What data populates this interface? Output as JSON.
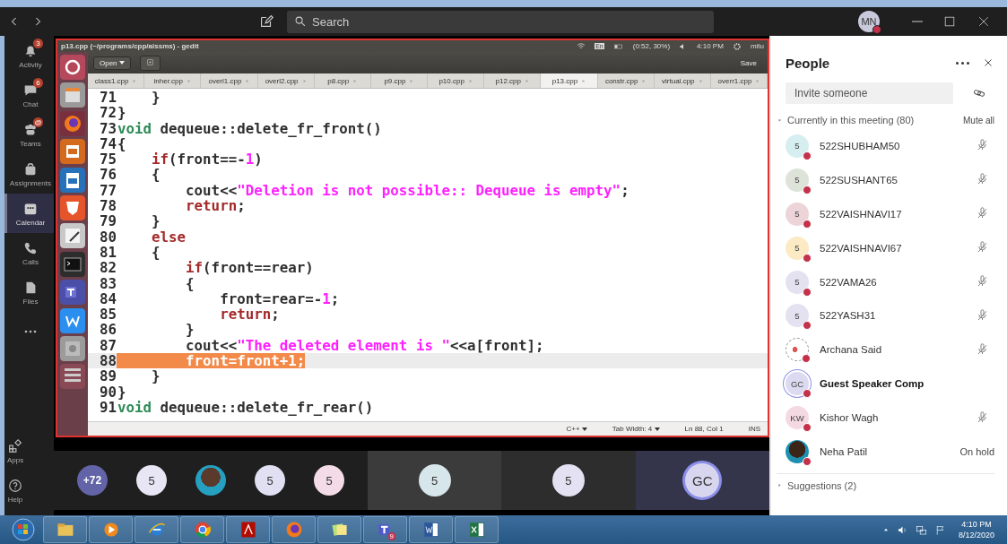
{
  "top_bar": {
    "search_placeholder": "Search",
    "avatar": "MN"
  },
  "rail": [
    {
      "kind": "bell",
      "label": "Activity",
      "badge": "3",
      "selected": false
    },
    {
      "kind": "chat",
      "label": "Chat",
      "badge": "6",
      "selected": false
    },
    {
      "kind": "teams",
      "label": "Teams",
      "badge": "@",
      "selected": false
    },
    {
      "kind": "bag",
      "label": "Assignments",
      "selected": false
    },
    {
      "kind": "calendar",
      "label": "Calendar",
      "selected": true
    },
    {
      "kind": "phone",
      "label": "Calls",
      "selected": false
    },
    {
      "kind": "file",
      "label": "Files",
      "selected": false
    },
    {
      "kind": "more",
      "selected": false
    }
  ],
  "rail_bottom": [
    {
      "kind": "apps",
      "label": "Apps",
      "selected": false
    },
    {
      "kind": "help",
      "label": "Help",
      "selected": false
    }
  ],
  "gedit": {
    "title": "p13.cpp (~/programs/cpp/aissms) - gedit",
    "indicators": {
      "keyboard": "En",
      "battery": "(0:52, 30%)",
      "clock": "4:10 PM",
      "user": "mitu"
    },
    "open_button": "Open",
    "save_button": "Save",
    "tabs": [
      {
        "label": "class1.cpp",
        "selected": false
      },
      {
        "label": "inher.cpp",
        "selected": false
      },
      {
        "label": "overl1.cpp",
        "selected": false
      },
      {
        "label": "overl2.cpp",
        "selected": false
      },
      {
        "label": "p8.cpp",
        "selected": false
      },
      {
        "label": "p9.cpp",
        "selected": false
      },
      {
        "label": "p10.cpp",
        "selected": false
      },
      {
        "label": "p12.cpp",
        "selected": false
      },
      {
        "label": "p13.cpp",
        "selected": true
      },
      {
        "label": "constr.cpp",
        "selected": false
      },
      {
        "label": "virtual.cpp",
        "selected": false
      },
      {
        "label": "overr1.cpp",
        "selected": false
      }
    ],
    "lines": [
      {
        "number": "71",
        "selected": false,
        "segments": [
          {
            "text": "    }",
            "kind": "plain"
          }
        ]
      },
      {
        "number": "72",
        "selected": false,
        "segments": [
          {
            "text": "}",
            "kind": "plain"
          }
        ]
      },
      {
        "number": "73",
        "selected": false,
        "segments": [
          {
            "text": "void",
            "kind": "type"
          },
          {
            "text": " dequeue::delete_fr_front()",
            "kind": "plain"
          }
        ]
      },
      {
        "number": "74",
        "selected": false,
        "segments": [
          {
            "text": "{",
            "kind": "plain"
          }
        ]
      },
      {
        "number": "75",
        "selected": false,
        "segments": [
          {
            "text": "    if",
            "kind": "keyword"
          },
          {
            "text": "(front==-",
            "kind": "plain"
          },
          {
            "text": "1",
            "kind": "number"
          },
          {
            "text": ")",
            "kind": "plain"
          }
        ]
      },
      {
        "number": "76",
        "selected": false,
        "segments": [
          {
            "text": "    {",
            "kind": "plain"
          }
        ]
      },
      {
        "number": "77",
        "selected": false,
        "segments": [
          {
            "text": "        cout<<",
            "kind": "plain"
          },
          {
            "text": "\"Deletion is not possible:: Dequeue is empty\"",
            "kind": "string"
          },
          {
            "text": ";",
            "kind": "plain"
          }
        ]
      },
      {
        "number": "78",
        "selected": false,
        "segments": [
          {
            "text": "        return",
            "kind": "keyword"
          },
          {
            "text": ";",
            "kind": "plain"
          }
        ]
      },
      {
        "number": "79",
        "selected": false,
        "segments": [
          {
            "text": "    }",
            "kind": "plain"
          }
        ]
      },
      {
        "number": "80",
        "selected": false,
        "segments": [
          {
            "text": "    else",
            "kind": "keyword"
          }
        ]
      },
      {
        "number": "81",
        "selected": false,
        "segments": [
          {
            "text": "    {",
            "kind": "plain"
          }
        ]
      },
      {
        "number": "82",
        "selected": false,
        "segments": [
          {
            "text": "        if",
            "kind": "keyword"
          },
          {
            "text": "(front==rear)",
            "kind": "plain"
          }
        ]
      },
      {
        "number": "83",
        "selected": false,
        "segments": [
          {
            "text": "        {",
            "kind": "plain"
          }
        ]
      },
      {
        "number": "84",
        "selected": false,
        "segments": [
          {
            "text": "            front=rear=-",
            "kind": "plain"
          },
          {
            "text": "1",
            "kind": "number"
          },
          {
            "text": ";",
            "kind": "plain"
          }
        ]
      },
      {
        "number": "85",
        "selected": false,
        "segments": [
          {
            "text": "            return",
            "kind": "keyword"
          },
          {
            "text": ";",
            "kind": "plain"
          }
        ]
      },
      {
        "number": "86",
        "selected": false,
        "segments": [
          {
            "text": "        }",
            "kind": "plain"
          }
        ]
      },
      {
        "number": "87",
        "selected": false,
        "segments": [
          {
            "text": "        cout<<",
            "kind": "plain"
          },
          {
            "text": "\"The deleted element is \"",
            "kind": "string"
          },
          {
            "text": "<<a[front];",
            "kind": "plain"
          }
        ]
      },
      {
        "number": "88",
        "selected": true,
        "segments": [
          {
            "text": "        front=front+1;",
            "kind": "plain"
          }
        ]
      },
      {
        "number": "89",
        "selected": false,
        "segments": [
          {
            "text": "    }",
            "kind": "plain"
          }
        ]
      },
      {
        "number": "90",
        "selected": false,
        "segments": [
          {
            "text": "}",
            "kind": "plain"
          }
        ]
      },
      {
        "number": "91",
        "selected": false,
        "segments": [
          {
            "text": "void",
            "kind": "type"
          },
          {
            "text": " dequeue::delete_fr_rear()",
            "kind": "plain"
          }
        ]
      }
    ],
    "status": {
      "language": "C++",
      "tab_width": "Tab Width: 4",
      "position": "Ln 88, Col 1",
      "mode": "INS"
    }
  },
  "participants": [
    {
      "kind": "overflow",
      "label": "+72",
      "color": "#6264a7"
    },
    {
      "kind": "initials",
      "label": "5",
      "color": "#e8e6f4"
    },
    {
      "kind": "photo"
    },
    {
      "kind": "initials",
      "label": "5",
      "color": "#e1dff2"
    },
    {
      "kind": "initials",
      "label": "5",
      "color": "#f3dce7"
    },
    {
      "kind": "tile",
      "label": "5",
      "color": "#d6e6ea"
    },
    {
      "kind": "tile",
      "label": "5",
      "color": "#e3e1f2"
    },
    {
      "kind": "speaker",
      "label": "GC",
      "color": "#d8d6ee"
    }
  ],
  "people": {
    "title": "People",
    "invite_placeholder": "Invite someone",
    "section": "Currently in this meeting (80)",
    "mute_all": "Mute all",
    "members": [
      {
        "kind": "initials",
        "initials": "5",
        "color": "#d7eef1",
        "name": "522SHUBHAM50",
        "muted": true,
        "presenting": false
      },
      {
        "kind": "initials",
        "initials": "5",
        "color": "#dde3d8",
        "name": "522SUSHANT65",
        "muted": true,
        "presenting": false
      },
      {
        "kind": "initials",
        "initials": "5",
        "color": "#ecd4d8",
        "name": "522VAISHNAVI17",
        "muted": true,
        "presenting": false
      },
      {
        "kind": "initials",
        "initials": "5",
        "color": "#fbeac4",
        "name": "522VAISHNAVI67",
        "muted": true,
        "presenting": false
      },
      {
        "kind": "initials",
        "initials": "5",
        "color": "#e4e1f1",
        "name": "522VAMA26",
        "muted": true,
        "presenting": false
      },
      {
        "kind": "initials",
        "initials": "5",
        "color": "#e4e1f1",
        "name": "522YASH31",
        "muted": true,
        "presenting": false
      },
      {
        "kind": "picture",
        "name": "Archana Said",
        "muted": true,
        "presenting": false
      },
      {
        "kind": "initials",
        "initials": "GC",
        "color": "#dcdaf0",
        "name": "Guest Speaker Comp",
        "muted": false,
        "presenting": true
      },
      {
        "kind": "initials",
        "initials": "KW",
        "color": "#f5d9e2",
        "name": "Kishor Wagh",
        "muted": true,
        "presenting": false
      },
      {
        "kind": "photo",
        "name": "Neha Patil",
        "muted": false,
        "presenting": false,
        "status": "On hold"
      }
    ],
    "suggestions": "Suggestions (2)"
  },
  "taskbar": {
    "apps": [
      {
        "kind": "folder"
      },
      {
        "kind": "media"
      },
      {
        "kind": "ie"
      },
      {
        "kind": "chrome"
      },
      {
        "kind": "acrobat"
      },
      {
        "kind": "firefox"
      },
      {
        "kind": "notes"
      },
      {
        "kind": "teams",
        "badge": "9"
      },
      {
        "kind": "word"
      },
      {
        "kind": "excel"
      }
    ],
    "clock": "4:10 PM",
    "date": "8/12/2020"
  }
}
